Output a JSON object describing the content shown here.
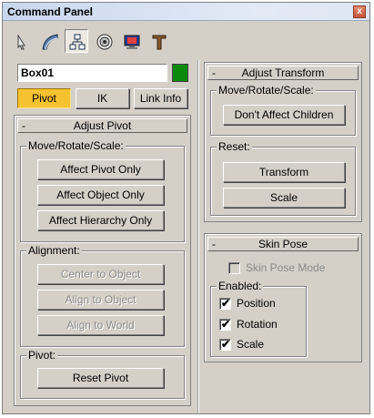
{
  "window": {
    "title": "Command Panel",
    "close_glyph": "x"
  },
  "toolbar": {
    "tabs": [
      {
        "name": "create-icon",
        "active": false
      },
      {
        "name": "modify-icon",
        "active": false
      },
      {
        "name": "hierarchy-icon",
        "active": true
      },
      {
        "name": "motion-icon",
        "active": false
      },
      {
        "name": "display-icon",
        "active": false
      },
      {
        "name": "utilities-icon",
        "active": false
      }
    ]
  },
  "object": {
    "name": "Box01",
    "color": "#0a8a0a"
  },
  "mode_tabs": {
    "pivot": "Pivot",
    "ik": "IK",
    "link_info": "Link Info"
  },
  "adjust_pivot": {
    "sign": "-",
    "title": "Adjust Pivot",
    "move_group": "Move/Rotate/Scale:",
    "affect_pivot": "Affect Pivot Only",
    "affect_object": "Affect Object Only",
    "affect_hierarchy": "Affect Hierarchy Only",
    "alignment_group": "Alignment:",
    "center_to_object": "Center to Object",
    "align_to_object": "Align to Object",
    "align_to_world": "Align to World",
    "pivot_group": "Pivot:",
    "reset_pivot": "Reset Pivot"
  },
  "adjust_transform": {
    "sign": "-",
    "title": "Adjust Transform",
    "move_group": "Move/Rotate/Scale:",
    "dont_affect_children": "Don't Affect Children",
    "reset_group": "Reset:",
    "transform": "Transform",
    "scale": "Scale"
  },
  "skin_pose": {
    "sign": "-",
    "title": "Skin Pose",
    "skin_pose_mode": "Skin Pose Mode",
    "enabled_group": "Enabled:",
    "position": "Position",
    "rotation": "Rotation",
    "scale": "Scale",
    "check_glyph": "✔"
  }
}
